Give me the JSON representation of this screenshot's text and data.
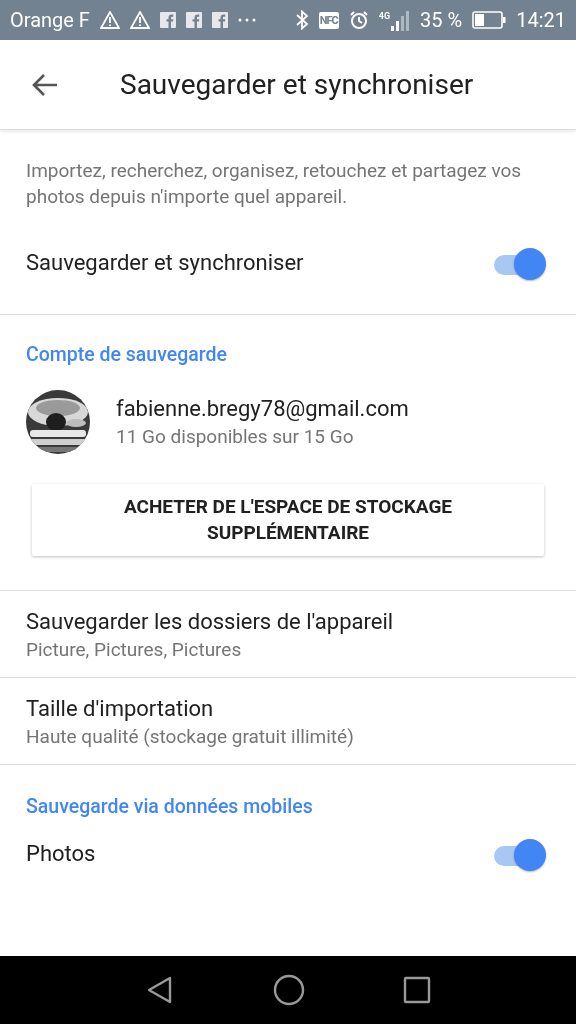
{
  "status_bar": {
    "carrier": "Orange F",
    "nfc": "NFC",
    "network": "4G",
    "battery": "35 %",
    "time": "14:21"
  },
  "app_bar": {
    "title": "Sauvegarder et synchroniser"
  },
  "description": "Importez, recherchez, organisez, retouchez et partagez vos photos depuis n'importe quel appareil.",
  "main_toggle": {
    "label": "Sauvegarder et synchroniser",
    "on": true
  },
  "account_section": {
    "header": "Compte de sauvegarde",
    "email": "fabienne.bregy78@gmail.com",
    "storage": "11 Go disponibles sur 15 Go",
    "button": "ACHETER DE L'ESPACE DE STOCKAGE SUPPLÉMENTAIRE"
  },
  "settings": [
    {
      "title": "Sauvegarder les dossiers de l'appareil",
      "subtitle": "Picture, Pictures, Pictures"
    },
    {
      "title": "Taille d'importation",
      "subtitle": "Haute qualité (stockage gratuit illimité)"
    }
  ],
  "mobile_section": {
    "header": "Sauvegarde via données mobiles",
    "items": [
      {
        "label": "Photos",
        "on": true
      }
    ]
  }
}
